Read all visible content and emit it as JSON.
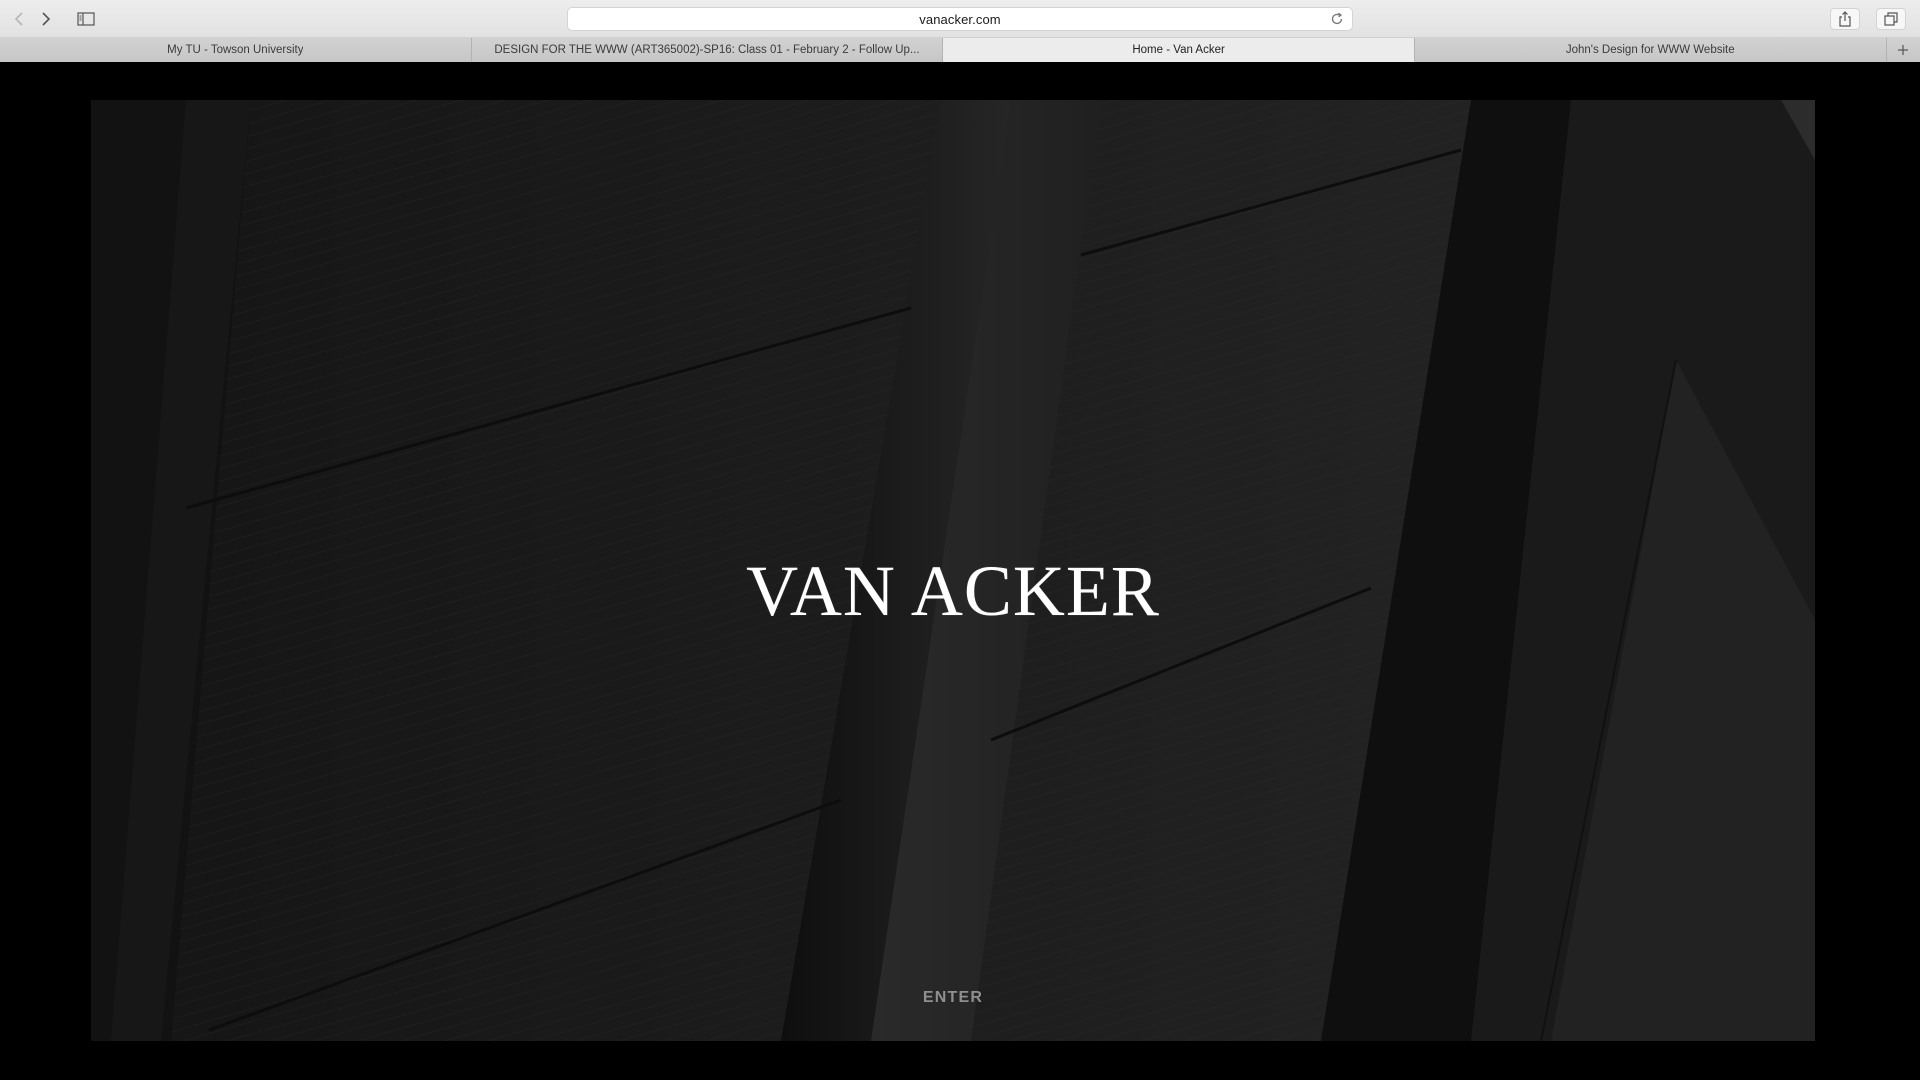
{
  "browser": {
    "address": "vanacker.com",
    "tabs": [
      {
        "title": "My TU - Towson University",
        "active": false
      },
      {
        "title": "DESIGN FOR THE WWW (ART365002)-SP16: Class 01 - February 2 - Follow Up...",
        "active": false
      },
      {
        "title": "Home - Van Acker",
        "active": true
      },
      {
        "title": "John's Design for WWW Website",
        "active": false
      }
    ],
    "icons": [
      "back-icon",
      "forward-icon",
      "sidebar-icon",
      "reload-icon",
      "share-icon",
      "tabs-overview-icon",
      "new-tab-icon"
    ]
  },
  "page": {
    "brand": "VAN ACKER",
    "enter_label": "ENTER"
  },
  "colors": {
    "page_background": "#000000",
    "brand_text": "#ffffff",
    "enter_text": "#8f8f8f"
  }
}
